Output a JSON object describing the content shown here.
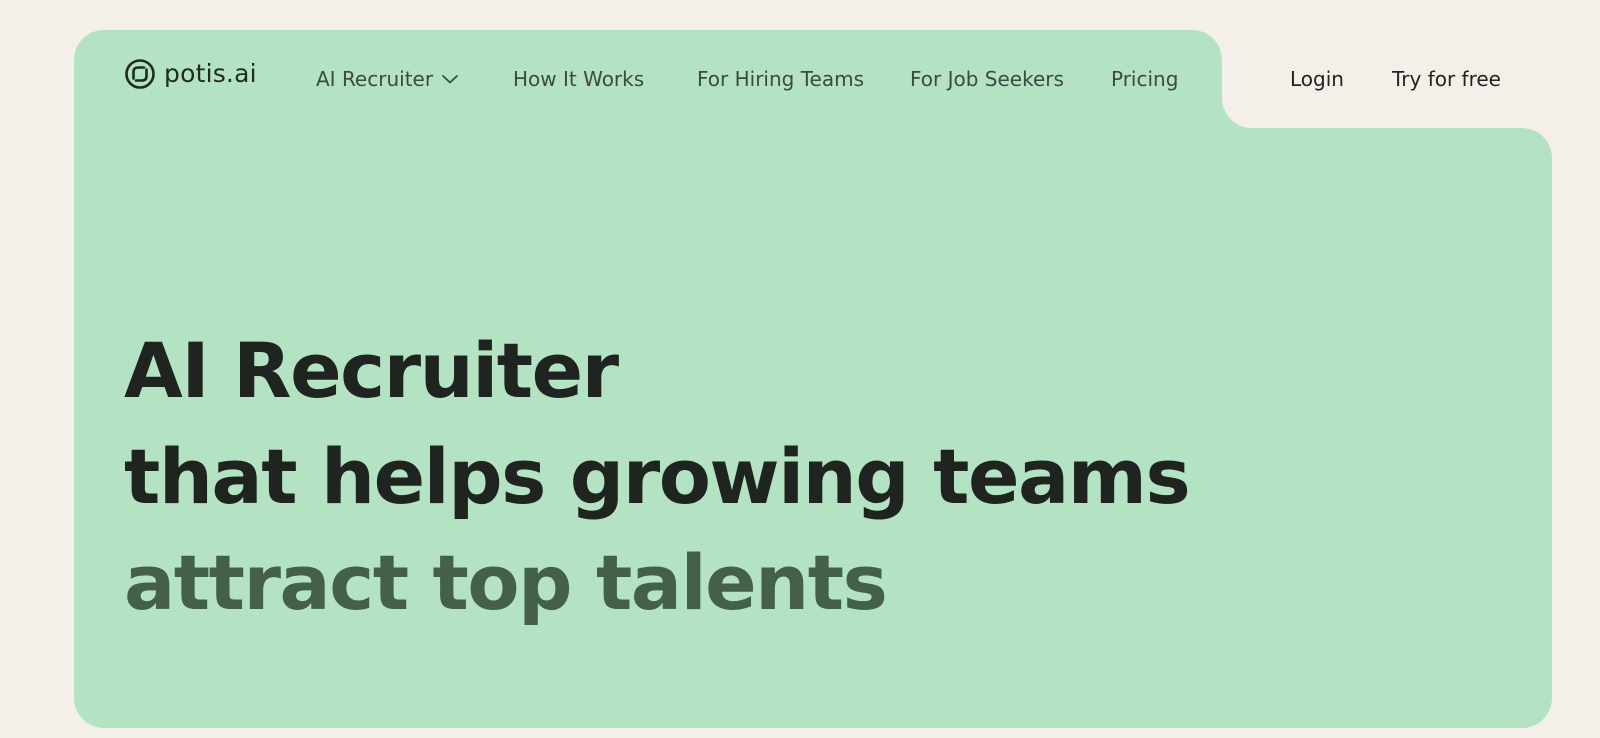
{
  "brand": {
    "name": "potis.ai",
    "icon": "potis-logo-icon"
  },
  "nav": {
    "items": [
      {
        "label": "AI Recruiter",
        "has_dropdown": true,
        "icon": "chevron-down-icon"
      },
      {
        "label": "How It Works"
      },
      {
        "label": "For Hiring Teams"
      },
      {
        "label": "For Job Seekers"
      },
      {
        "label": "Pricing"
      }
    ]
  },
  "auth": {
    "login_label": "Login",
    "signup_label": "Try for free"
  },
  "hero": {
    "line1": "AI Recruiter",
    "line2": "that helps growing teams",
    "line3": "attract top talents"
  },
  "colors": {
    "page_background": "#f5efea",
    "hero_background": "#b4e3c3",
    "text_dark": "#1f2420",
    "text_accent": "#44604b",
    "nav_text": "#3c4a41"
  }
}
